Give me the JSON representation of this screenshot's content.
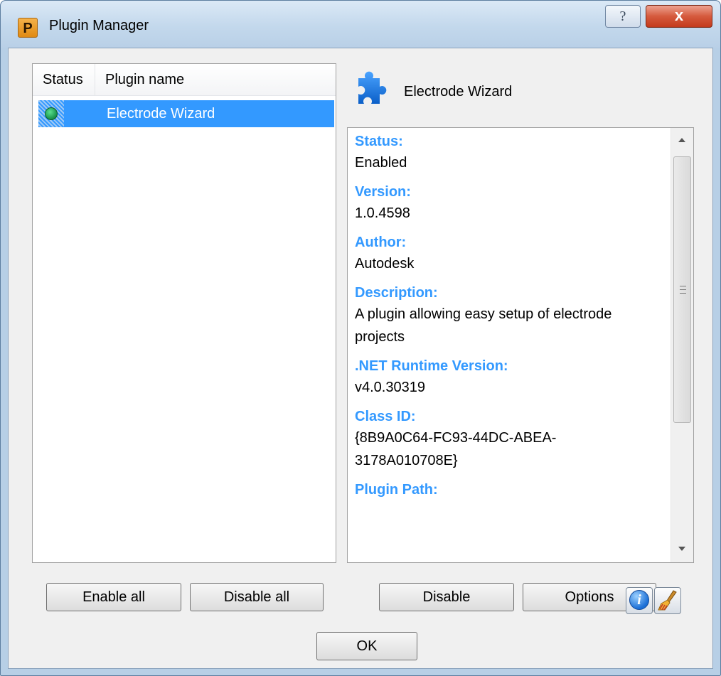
{
  "window": {
    "title": "Plugin Manager",
    "app_icon_letter": "P",
    "help_label": "?",
    "close_label": "x"
  },
  "plugin_list": {
    "columns": [
      "Status",
      "Plugin name"
    ],
    "rows": [
      {
        "status": "enabled",
        "name": "Electrode Wizard",
        "selected": true
      }
    ]
  },
  "details": {
    "plugin_name": "Electrode Wizard",
    "fields": [
      {
        "label": "Status:",
        "value": "Enabled"
      },
      {
        "label": "Version:",
        "value": "1.0.4598"
      },
      {
        "label": "Author:",
        "value": "Autodesk"
      },
      {
        "label": "Description:",
        "value": "A plugin allowing easy setup of electrode projects"
      },
      {
        "label": ".NET Runtime Version:",
        "value": "v4.0.30319"
      },
      {
        "label": "Class ID:",
        "value": "{8B9A0C64-FC93-44DC-ABEA-3178A010708E}"
      },
      {
        "label": "Plugin Path:",
        "value": ""
      }
    ]
  },
  "buttons": {
    "enable_all": "Enable all",
    "disable_all": "Disable all",
    "disable": "Disable",
    "options": "Options",
    "ok": "OK"
  },
  "colors": {
    "selection": "#3399ff",
    "field_label": "#3399ff",
    "status_enabled": "#1f9c52"
  }
}
